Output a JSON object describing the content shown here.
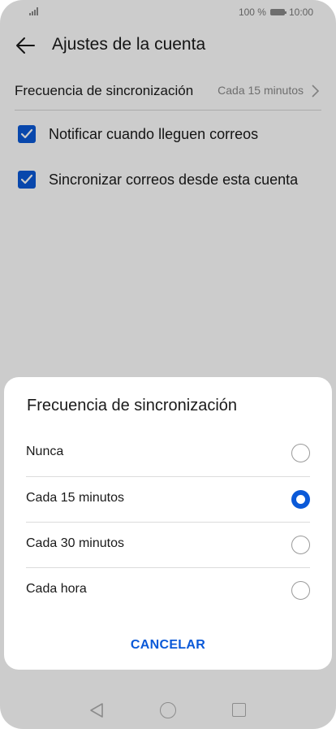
{
  "status_bar": {
    "battery_text": "100 %",
    "time": "10:00"
  },
  "header": {
    "title": "Ajustes de la cuenta",
    "back_icon": "arrow-left-icon"
  },
  "settings": {
    "sync_frequency": {
      "label": "Frecuencia de sincronización",
      "value": "Cada 15 minutos"
    },
    "checkboxes": [
      {
        "label": "Notificar cuando lleguen correos",
        "checked": true
      },
      {
        "label": "Sincronizar correos desde esta cuenta",
        "checked": true
      }
    ]
  },
  "dialog": {
    "title": "Frecuencia de sincronización",
    "options": [
      {
        "label": "Nunca",
        "selected": false
      },
      {
        "label": "Cada 15 minutos",
        "selected": true
      },
      {
        "label": "Cada 30 minutos",
        "selected": false
      },
      {
        "label": "Cada hora",
        "selected": false
      }
    ],
    "cancel_label": "CANCELAR"
  },
  "colors": {
    "accent": "#0a59d8",
    "overlay": "rgba(0,0,0,0.2)"
  }
}
